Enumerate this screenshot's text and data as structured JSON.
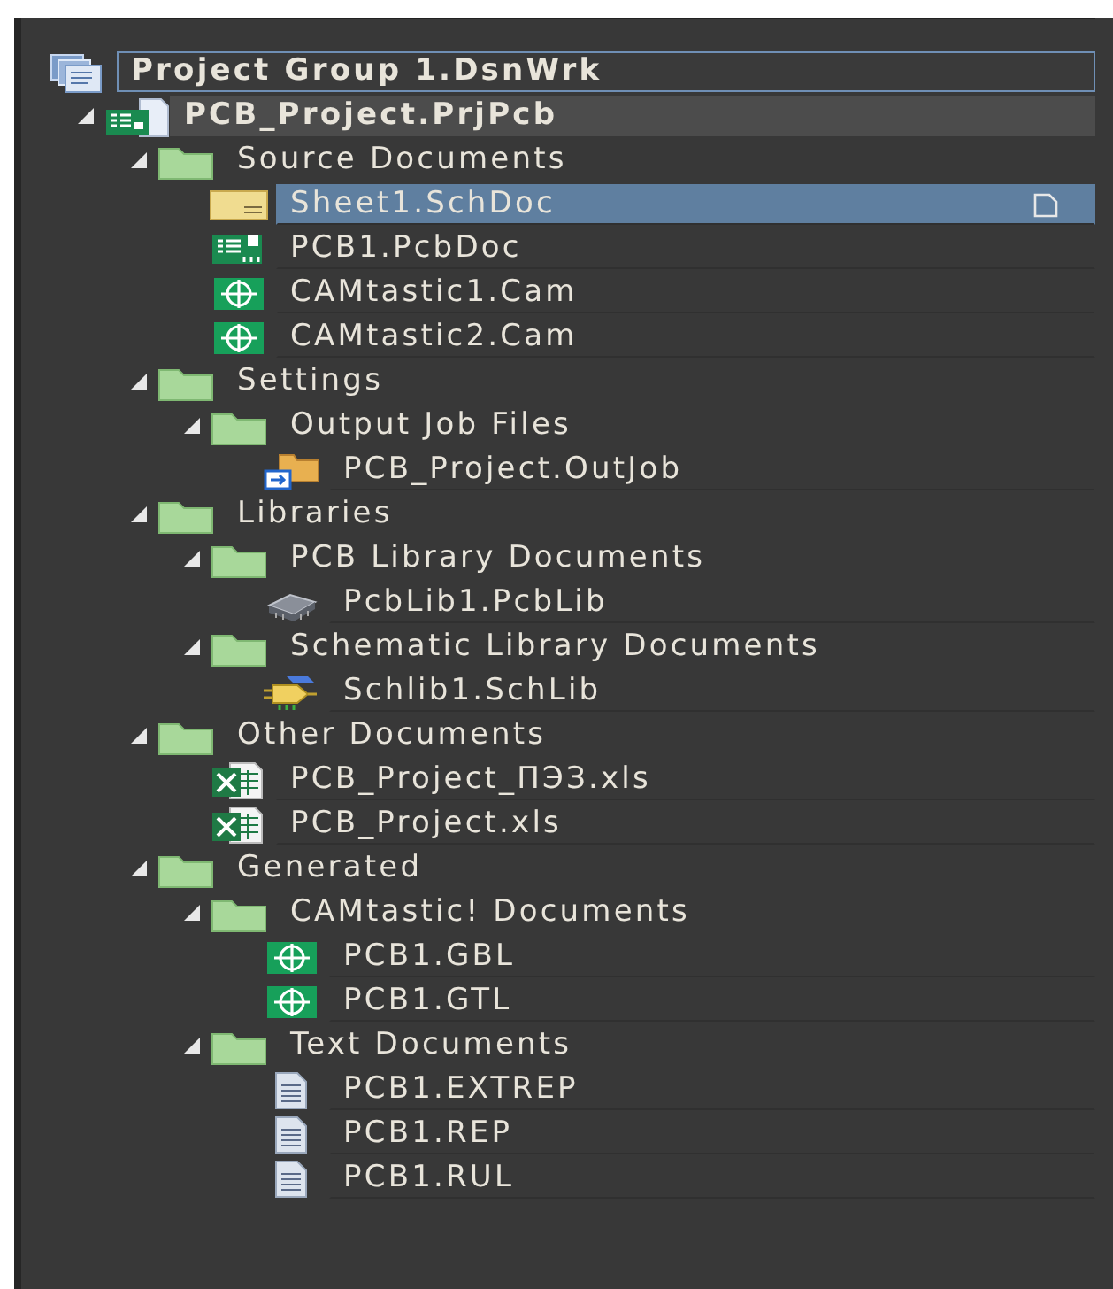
{
  "project_group": {
    "kind": "group",
    "label": "Project Group 1.DsnWrk",
    "focused": true,
    "children": [
      {
        "kind": "project",
        "label": "PCB_Project.PrjPcb",
        "expanded": true,
        "active": true,
        "selected": false,
        "children": [
          {
            "kind": "folder",
            "label": "Source Documents",
            "expanded": true,
            "selected": false,
            "children": [
              {
                "kind": "schdoc",
                "label": "Sheet1.SchDoc",
                "selected": true
              },
              {
                "kind": "pcbdoc",
                "label": "PCB1.PcbDoc",
                "selected": false
              },
              {
                "kind": "cam",
                "label": "CAMtastic1.Cam",
                "selected": false
              },
              {
                "kind": "cam",
                "label": "CAMtastic2.Cam",
                "selected": false
              }
            ]
          },
          {
            "kind": "folder",
            "label": "Settings",
            "expanded": true,
            "selected": false,
            "children": [
              {
                "kind": "folder",
                "label": "Output Job Files",
                "expanded": true,
                "selected": false,
                "children": [
                  {
                    "kind": "outjob",
                    "label": "PCB_Project.OutJob",
                    "selected": false
                  }
                ]
              }
            ]
          },
          {
            "kind": "folder",
            "label": "Libraries",
            "expanded": true,
            "selected": false,
            "children": [
              {
                "kind": "folder",
                "label": "PCB Library Documents",
                "expanded": true,
                "selected": false,
                "children": [
                  {
                    "kind": "pcblib",
                    "label": "PcbLib1.PcbLib",
                    "selected": false
                  }
                ]
              },
              {
                "kind": "folder",
                "label": "Schematic Library Documents",
                "expanded": true,
                "selected": false,
                "children": [
                  {
                    "kind": "schlib",
                    "label": "Schlib1.SchLib",
                    "selected": false
                  }
                ]
              }
            ]
          },
          {
            "kind": "folder",
            "label": "Other Documents",
            "expanded": true,
            "selected": false,
            "children": [
              {
                "kind": "xls",
                "label": "PCB_Project_ПЭЗ.xls",
                "selected": false
              },
              {
                "kind": "xls",
                "label": "PCB_Project.xls",
                "selected": false
              }
            ]
          },
          {
            "kind": "folder",
            "label": "Generated",
            "expanded": true,
            "selected": false,
            "children": [
              {
                "kind": "folder",
                "label": "CAMtastic! Documents",
                "expanded": true,
                "selected": false,
                "children": [
                  {
                    "kind": "cam",
                    "label": "PCB1.GBL",
                    "selected": false
                  },
                  {
                    "kind": "cam",
                    "label": "PCB1.GTL",
                    "selected": false
                  }
                ]
              },
              {
                "kind": "folder",
                "label": "Text Documents",
                "expanded": true,
                "selected": false,
                "children": [
                  {
                    "kind": "text",
                    "label": "PCB1.EXTREP",
                    "selected": false
                  },
                  {
                    "kind": "text",
                    "label": "PCB1.REP",
                    "selected": false
                  },
                  {
                    "kind": "text",
                    "label": "PCB1.RUL",
                    "selected": false
                  }
                ]
              }
            ]
          }
        ]
      }
    ]
  }
}
